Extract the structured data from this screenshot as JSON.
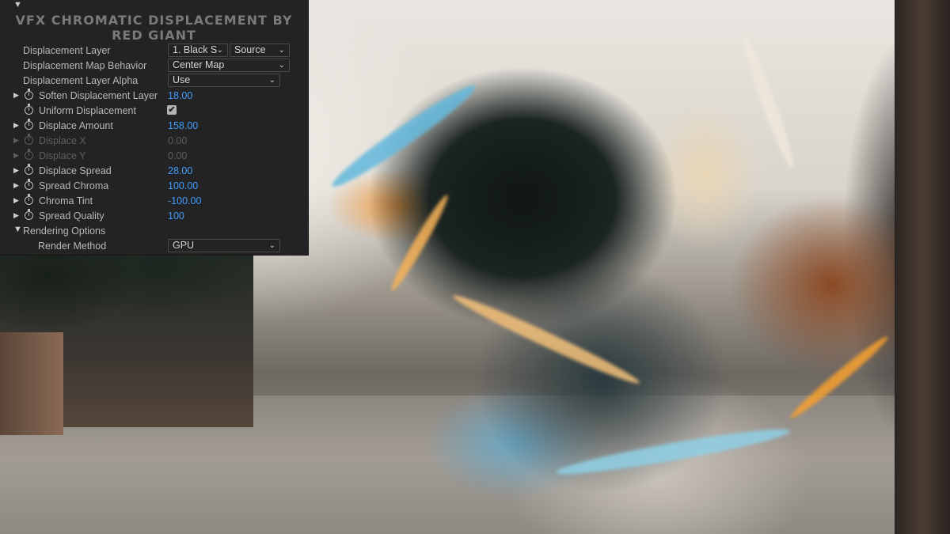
{
  "panel": {
    "title": "VFX CHROMATIC DISPLACEMENT BY RED GIANT",
    "collapse_glyph": "▼",
    "properties": [
      {
        "label": "Displacement Layer",
        "dropdowns": [
          "1. Black S",
          "Source"
        ]
      },
      {
        "label": "Displacement Map Behavior",
        "dropdowns": [
          "Center Map"
        ]
      },
      {
        "label": "Displacement Layer Alpha",
        "dropdowns": [
          "Use"
        ]
      },
      {
        "label": "Soften Displacement Layer",
        "value": "18.00"
      },
      {
        "label": "Uniform Displacement",
        "checked": true,
        "check_glyph": "✔"
      },
      {
        "label": "Displace Amount",
        "value": "158.00"
      },
      {
        "label": "Displace X",
        "value": "0.00",
        "disabled": true
      },
      {
        "label": "Displace Y",
        "value": "0.00",
        "disabled": true
      },
      {
        "label": "Displace Spread",
        "value": "28.00"
      },
      {
        "label": "Spread Chroma",
        "value": "100.00"
      },
      {
        "label": "Chroma Tint",
        "value": "-100.00"
      },
      {
        "label": "Spread Quality",
        "value": "100"
      },
      {
        "label": "Rendering Options",
        "group": true
      },
      {
        "label": "Render Method",
        "dropdowns": [
          "GPU"
        ]
      }
    ],
    "twirl_closed": "▶",
    "twirl_open": "▼",
    "chevron": "⌄"
  },
  "colors": {
    "panel_bg": "#232323",
    "value_blue": "#3f9cff",
    "label_gray": "#b8b8b8",
    "disabled_gray": "#5f5f5f"
  },
  "icons": {
    "stopwatch": "stopwatch-icon",
    "twirl": "disclosure-triangle-icon",
    "dropdown": "chevron-down-icon"
  }
}
